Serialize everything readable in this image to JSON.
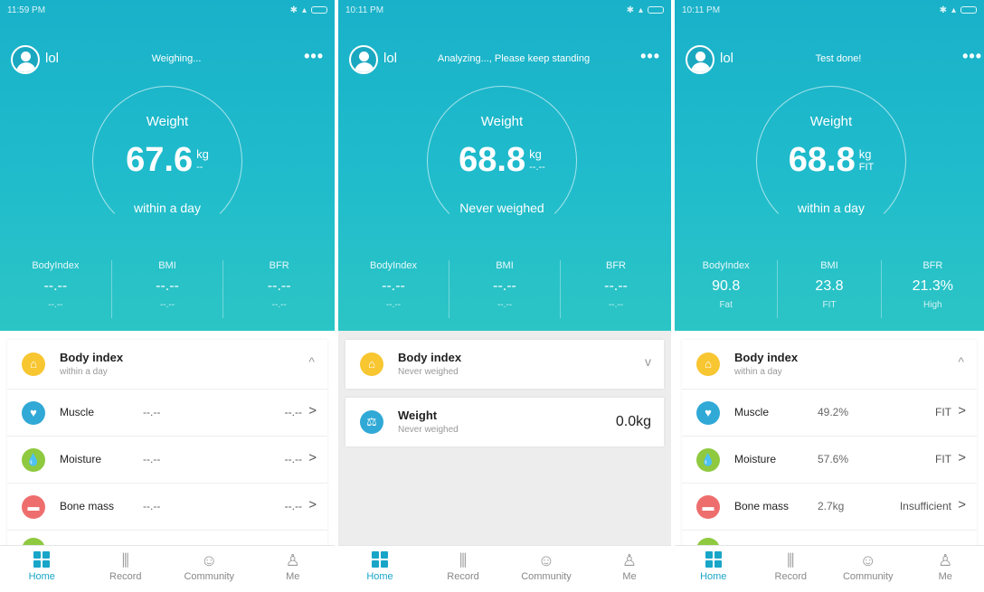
{
  "colors": {
    "accent": "#19a5c8",
    "hero_top": "#19b1c9",
    "hero_bottom": "#2cc5c5"
  },
  "screens": [
    {
      "status_time": "11:59 PM",
      "user": "lol",
      "status_msg": "Weighing...",
      "more": "•••",
      "ring": {
        "label": "Weight",
        "value": "67.6",
        "unit": "kg",
        "sub": "--",
        "caption": "within a day"
      },
      "stats": [
        {
          "label": "BodyIndex",
          "value": "--.--",
          "category": "--.--"
        },
        {
          "label": "BMI",
          "value": "--.--",
          "category": "--.--"
        },
        {
          "label": "BFR",
          "value": "--.--",
          "category": "--.--"
        }
      ],
      "card": {
        "title": "Body index",
        "subtitle": "within a day",
        "chevron": "^"
      },
      "rows": [
        {
          "name": "Muscle",
          "value": "--.--",
          "assess": "--.--",
          "arrow": ">"
        },
        {
          "name": "Moisture",
          "value": "--.--",
          "assess": "--.--",
          "arrow": ">"
        },
        {
          "name": "Bone mass",
          "value": "--.--",
          "assess": "--.--",
          "arrow": ">"
        }
      ]
    },
    {
      "status_time": "10:11 PM",
      "user": "lol",
      "status_msg": "Analyzing..., Please keep standing",
      "more": "•••",
      "ring": {
        "label": "Weight",
        "value": "68.8",
        "unit": "kg",
        "sub": "--.--",
        "caption": "Never weighed"
      },
      "stats": [
        {
          "label": "BodyIndex",
          "value": "--.--",
          "category": "--.--"
        },
        {
          "label": "BMI",
          "value": "--.--",
          "category": "--.--"
        },
        {
          "label": "BFR",
          "value": "--.--",
          "category": "--.--"
        }
      ],
      "card": {
        "title": "Body index",
        "subtitle": "Never weighed",
        "chevron": "v"
      },
      "weight_card": {
        "title": "Weight",
        "subtitle": "Never weighed",
        "value": "0.0kg"
      }
    },
    {
      "status_time": "10:11 PM",
      "user": "lol",
      "status_msg": "Test done!",
      "more": "•••",
      "ring": {
        "label": "Weight",
        "value": "68.8",
        "unit": "kg",
        "sub": "FIT",
        "caption": "within a day"
      },
      "stats": [
        {
          "label": "BodyIndex",
          "value": "90.8",
          "category": "Fat"
        },
        {
          "label": "BMI",
          "value": "23.8",
          "category": "FIT"
        },
        {
          "label": "BFR",
          "value": "21.3%",
          "category": "High"
        }
      ],
      "card": {
        "title": "Body index",
        "subtitle": "within a day",
        "chevron": "^"
      },
      "rows": [
        {
          "name": "Muscle",
          "value": "49.2%",
          "assess": "FIT",
          "arrow": ">"
        },
        {
          "name": "Moisture",
          "value": "57.6%",
          "assess": "FIT",
          "arrow": ">"
        },
        {
          "name": "Bone mass",
          "value": "2.7kg",
          "assess": "Insufficient",
          "arrow": ">"
        }
      ]
    }
  ],
  "tabs": [
    {
      "label": "Home",
      "icon": "home-grid-icon"
    },
    {
      "label": "Record",
      "icon": "record-bars-icon"
    },
    {
      "label": "Community",
      "icon": "community-smile-icon"
    },
    {
      "label": "Me",
      "icon": "me-person-icon"
    }
  ]
}
